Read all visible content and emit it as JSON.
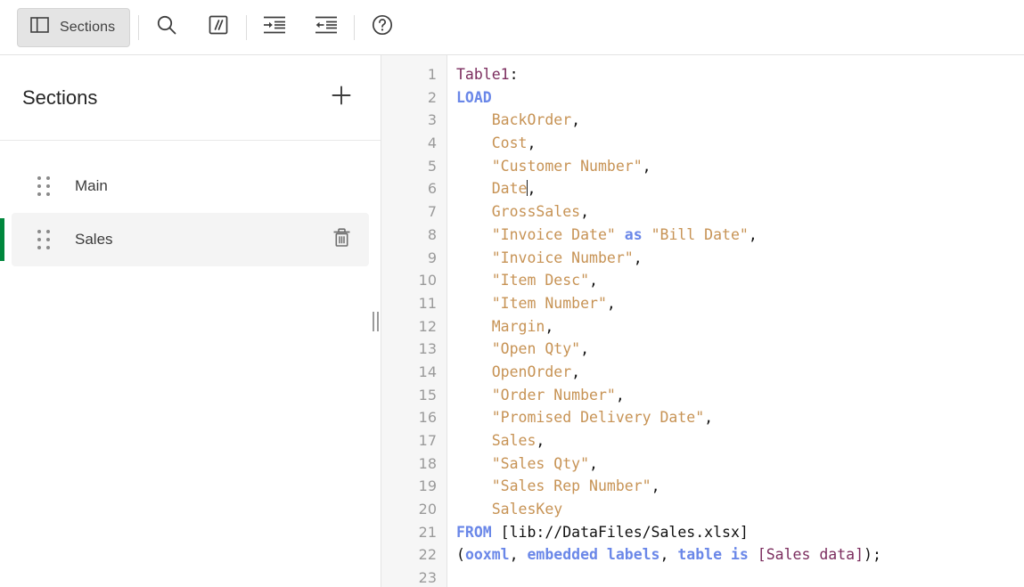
{
  "toolbar": {
    "sections_button": {
      "label": "Sections",
      "icon": "panel-layout-icon",
      "active": true
    },
    "buttons": [
      {
        "name": "search",
        "icon": "search-icon",
        "tooltip": "Search"
      },
      {
        "name": "comment",
        "icon": "comment-slashes-icon",
        "tooltip": "Comment"
      },
      {
        "name": "indent",
        "icon": "indent-increase-icon",
        "tooltip": "Indent"
      },
      {
        "name": "outdent",
        "icon": "indent-decrease-icon",
        "tooltip": "Outdent"
      },
      {
        "name": "help",
        "icon": "help-circle-icon",
        "tooltip": "Help"
      }
    ]
  },
  "sidebar": {
    "title": "Sections",
    "add_label": "+",
    "add_icon": "plus-icon",
    "items": [
      {
        "label": "Main",
        "selected": false,
        "drag_icon": "drag-dots-icon"
      },
      {
        "label": "Sales",
        "selected": true,
        "drag_icon": "drag-dots-icon",
        "delete_icon": "trash-icon"
      }
    ],
    "accent_color": "#00873d"
  },
  "editor": {
    "line_numbers": [
      "1",
      "2",
      "3",
      "4",
      "5",
      "6",
      "7",
      "8",
      "9",
      "10",
      "11",
      "12",
      "13",
      "14",
      "15",
      "16",
      "17",
      "18",
      "19",
      "20",
      "21",
      "22",
      "23"
    ],
    "colors": {
      "table_label": "#7b2d5e",
      "keyword": "#6a87e8",
      "field": "#c79355",
      "plain": "#111111",
      "gutter_text": "#9a9a9a",
      "gutter_bg": "#f6f6f6"
    },
    "lines": [
      {
        "n": 1,
        "text": "Table1:",
        "tokens": [
          {
            "t": "Table1",
            "c": "tok-table"
          },
          {
            "t": ":",
            "c": "tok-plain"
          }
        ]
      },
      {
        "n": 2,
        "text": "LOAD",
        "tokens": [
          {
            "t": "LOAD",
            "c": "tok-kw"
          }
        ]
      },
      {
        "n": 3,
        "text": "    BackOrder,",
        "tokens": [
          {
            "t": "    ",
            "c": "tok-plain"
          },
          {
            "t": "BackOrder",
            "c": "tok-field"
          },
          {
            "t": ",",
            "c": "tok-plain"
          }
        ]
      },
      {
        "n": 4,
        "text": "    Cost,",
        "tokens": [
          {
            "t": "    ",
            "c": "tok-plain"
          },
          {
            "t": "Cost",
            "c": "tok-field"
          },
          {
            "t": ",",
            "c": "tok-plain"
          }
        ]
      },
      {
        "n": 5,
        "text": "    \"Customer Number\",",
        "tokens": [
          {
            "t": "    ",
            "c": "tok-plain"
          },
          {
            "t": "\"Customer Number\"",
            "c": "tok-field"
          },
          {
            "t": ",",
            "c": "tok-plain"
          }
        ]
      },
      {
        "n": 6,
        "text": "    Date,",
        "tokens": [
          {
            "t": "    ",
            "c": "tok-plain"
          },
          {
            "t": "Date",
            "c": "tok-field"
          },
          {
            "t": "|CARET|",
            "c": "caret"
          },
          {
            "t": ",",
            "c": "tok-plain"
          }
        ]
      },
      {
        "n": 7,
        "text": "    GrossSales,",
        "tokens": [
          {
            "t": "    ",
            "c": "tok-plain"
          },
          {
            "t": "GrossSales",
            "c": "tok-field"
          },
          {
            "t": ",",
            "c": "tok-plain"
          }
        ]
      },
      {
        "n": 8,
        "text": "    \"Invoice Date\" as \"Bill Date\",",
        "tokens": [
          {
            "t": "    ",
            "c": "tok-plain"
          },
          {
            "t": "\"Invoice Date\" ",
            "c": "tok-field"
          },
          {
            "t": "as",
            "c": "tok-kw"
          },
          {
            "t": " \"Bill Date\"",
            "c": "tok-field"
          },
          {
            "t": ",",
            "c": "tok-plain"
          }
        ]
      },
      {
        "n": 9,
        "text": "    \"Invoice Number\",",
        "tokens": [
          {
            "t": "    ",
            "c": "tok-plain"
          },
          {
            "t": "\"Invoice Number\"",
            "c": "tok-field"
          },
          {
            "t": ",",
            "c": "tok-plain"
          }
        ]
      },
      {
        "n": 10,
        "text": "    \"Item Desc\",",
        "tokens": [
          {
            "t": "    ",
            "c": "tok-plain"
          },
          {
            "t": "\"Item Desc\"",
            "c": "tok-field"
          },
          {
            "t": ",",
            "c": "tok-plain"
          }
        ]
      },
      {
        "n": 11,
        "text": "    \"Item Number\",",
        "tokens": [
          {
            "t": "    ",
            "c": "tok-plain"
          },
          {
            "t": "\"Item Number\"",
            "c": "tok-field"
          },
          {
            "t": ",",
            "c": "tok-plain"
          }
        ]
      },
      {
        "n": 12,
        "text": "    Margin,",
        "tokens": [
          {
            "t": "    ",
            "c": "tok-plain"
          },
          {
            "t": "Margin",
            "c": "tok-field"
          },
          {
            "t": ",",
            "c": "tok-plain"
          }
        ]
      },
      {
        "n": 13,
        "text": "    \"Open Qty\",",
        "tokens": [
          {
            "t": "    ",
            "c": "tok-plain"
          },
          {
            "t": "\"Open Qty\"",
            "c": "tok-field"
          },
          {
            "t": ",",
            "c": "tok-plain"
          }
        ]
      },
      {
        "n": 14,
        "text": "    OpenOrder,",
        "tokens": [
          {
            "t": "    ",
            "c": "tok-plain"
          },
          {
            "t": "OpenOrder",
            "c": "tok-field"
          },
          {
            "t": ",",
            "c": "tok-plain"
          }
        ]
      },
      {
        "n": 15,
        "text": "    \"Order Number\",",
        "tokens": [
          {
            "t": "    ",
            "c": "tok-plain"
          },
          {
            "t": "\"Order Number\"",
            "c": "tok-field"
          },
          {
            "t": ",",
            "c": "tok-plain"
          }
        ]
      },
      {
        "n": 16,
        "text": "    \"Promised Delivery Date\",",
        "tokens": [
          {
            "t": "    ",
            "c": "tok-plain"
          },
          {
            "t": "\"Promised Delivery Date\"",
            "c": "tok-field"
          },
          {
            "t": ",",
            "c": "tok-plain"
          }
        ]
      },
      {
        "n": 17,
        "text": "    Sales,",
        "tokens": [
          {
            "t": "    ",
            "c": "tok-plain"
          },
          {
            "t": "Sales",
            "c": "tok-field"
          },
          {
            "t": ",",
            "c": "tok-plain"
          }
        ]
      },
      {
        "n": 18,
        "text": "    \"Sales Qty\",",
        "tokens": [
          {
            "t": "    ",
            "c": "tok-plain"
          },
          {
            "t": "\"Sales Qty\"",
            "c": "tok-field"
          },
          {
            "t": ",",
            "c": "tok-plain"
          }
        ]
      },
      {
        "n": 19,
        "text": "    \"Sales Rep Number\",",
        "tokens": [
          {
            "t": "    ",
            "c": "tok-plain"
          },
          {
            "t": "\"Sales Rep Number\"",
            "c": "tok-field"
          },
          {
            "t": ",",
            "c": "tok-plain"
          }
        ]
      },
      {
        "n": 20,
        "text": "    SalesKey",
        "tokens": [
          {
            "t": "    ",
            "c": "tok-plain"
          },
          {
            "t": "SalesKey",
            "c": "tok-field"
          }
        ]
      },
      {
        "n": 21,
        "text": "FROM [lib://DataFiles/Sales.xlsx]",
        "tokens": [
          {
            "t": "FROM",
            "c": "tok-kw"
          },
          {
            "t": " [lib://DataFiles/Sales.xlsx]",
            "c": "tok-plain"
          }
        ]
      },
      {
        "n": 22,
        "text": "(ooxml, embedded labels, table is [Sales data]);",
        "tokens": [
          {
            "t": "(",
            "c": "tok-plain"
          },
          {
            "t": "ooxml",
            "c": "tok-kw"
          },
          {
            "t": ", ",
            "c": "tok-plain"
          },
          {
            "t": "embedded labels",
            "c": "tok-kw"
          },
          {
            "t": ", ",
            "c": "tok-plain"
          },
          {
            "t": "table is",
            "c": "tok-kw"
          },
          {
            "t": " ",
            "c": "tok-plain"
          },
          {
            "t": "[Sales data]",
            "c": "tok-br"
          },
          {
            "t": ");",
            "c": "tok-plain"
          }
        ]
      },
      {
        "n": 23,
        "text": "",
        "tokens": []
      }
    ]
  },
  "splitter": {
    "icon": "vertical-grip-icon"
  }
}
